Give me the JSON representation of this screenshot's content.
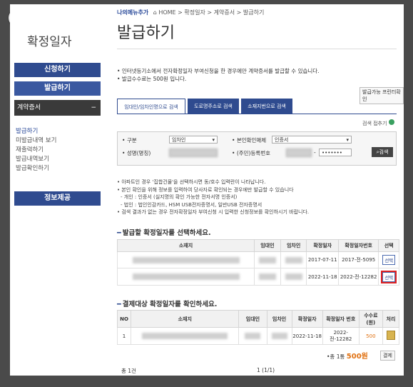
{
  "header": {
    "logo": "나의메뉴추가",
    "breadcrumb": "HOME > 확정일자 > 계약증서 > 발급하기"
  },
  "sidebar": {
    "title": "확정일자",
    "apply_btn": "신청하기",
    "issue_btn": "발급하기",
    "contract_sub": "계약증서",
    "links": [
      "발급하기",
      "미발급내역 보기",
      "재출력하기",
      "발급내역보기",
      "발급확인하기"
    ],
    "info_btn": "정보제공"
  },
  "main": {
    "title": "발급하기",
    "notices": [
      "인터넷등기소에서 전자확정일자 부여신청을 한 경우에만 계약증서를 발급할 수 있습니다.",
      "발급수수료는 500원 입니다."
    ],
    "print_info_btn": "발급가능 프린터확인",
    "tabs": [
      "임대인/임차인명으로 검색",
      "도로명주소로 검색",
      "소재지번으로 검색"
    ],
    "search_fold": "검색 접추기",
    "search": {
      "type_label": "구분",
      "type_value": "임차인",
      "verify_label": "본인확인매체",
      "verify_value": "인증서",
      "name_label": "성명(명칭)",
      "reg_label": "(주민)등록번호",
      "reg_value": "•••••••",
      "search_btn": "검색"
    },
    "info_lines": [
      "아파트인 경우 '집합건물'을 선택하시면 동/호수 입력란이 나타납니다.",
      "본인 확인을 위해 정보를 입력하여 당사자로 확인되는 경우에만 발급할 수 있습니다",
      "- 개인 : 인증서 (실지명의 확인 가능한 전자서명 인증서)",
      "- 법인 : 법인인감카드, HSM USB전자증명서, 일반USB 전자증명서",
      "검색 결과가 없는 경우 전자확정일자 부여신청 시 입력한 신청정보를 확인하시기 바랍니다."
    ],
    "select_heading": "발급할 확정일자를 선택하세요.",
    "select_table": {
      "headers": [
        "소재지",
        "임대인",
        "임차인",
        "확정일자",
        "확정일자번호",
        "선택"
      ],
      "rows": [
        {
          "date": "2017-07-11",
          "num": "2017-전-5095",
          "btn": "선택"
        },
        {
          "date": "2022-11-18",
          "num": "2022-전-12282",
          "btn": "선택"
        }
      ]
    },
    "pay_heading": "결제대상 확정일자를 확인하세요.",
    "pay_table": {
      "headers": [
        "NO",
        "소재지",
        "임대인",
        "임차인",
        "확정일자",
        "확정일자 번호",
        "수수료 (원)",
        "처리"
      ],
      "rows": [
        {
          "no": "1",
          "date": "2022-11-18",
          "num": "2022-전-12282",
          "fee": "500"
        }
      ]
    },
    "total_label": "•총 1통",
    "total_amount": "500원",
    "pay_btn": "결제",
    "count_text": "총 1건",
    "pager_text": "1 (1/1)"
  }
}
